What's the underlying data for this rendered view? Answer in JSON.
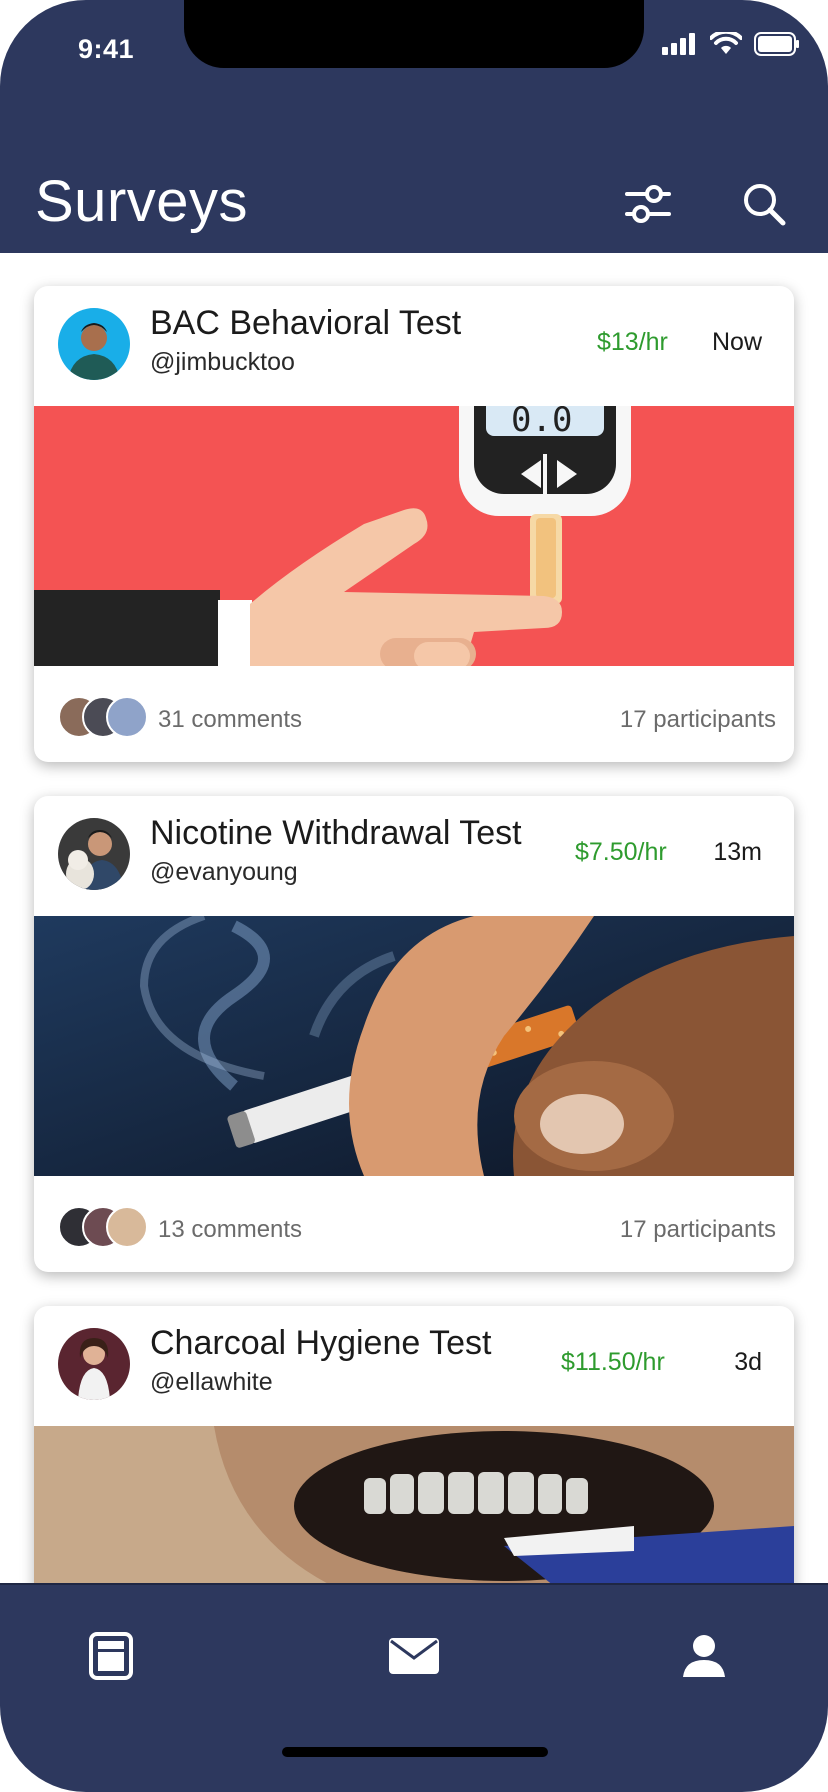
{
  "status_bar": {
    "time": "9:41"
  },
  "header": {
    "title": "Surveys",
    "filter_icon": "sliders-icon",
    "search_icon": "search-icon"
  },
  "colors": {
    "navy": "#2d385e",
    "rate_green": "#2e9b2e"
  },
  "surveys": [
    {
      "title": "BAC Behavioral Test",
      "user": "@jimbucktoo",
      "rate": "$13/hr",
      "time": "Now",
      "comments": "31 comments",
      "participants": "17 participants"
    },
    {
      "title": "Nicotine Withdrawal Test",
      "user": "@evanyoung",
      "rate": "$7.50/hr",
      "time": "13m",
      "comments": "13 comments",
      "participants": "17 participants"
    },
    {
      "title": "Charcoal Hygiene Test",
      "user": "@ellawhite",
      "rate": "$11.50/hr",
      "time": "3d"
    }
  ],
  "tabbar": {
    "items": [
      "feed-icon",
      "mail-icon",
      "profile-icon"
    ]
  }
}
